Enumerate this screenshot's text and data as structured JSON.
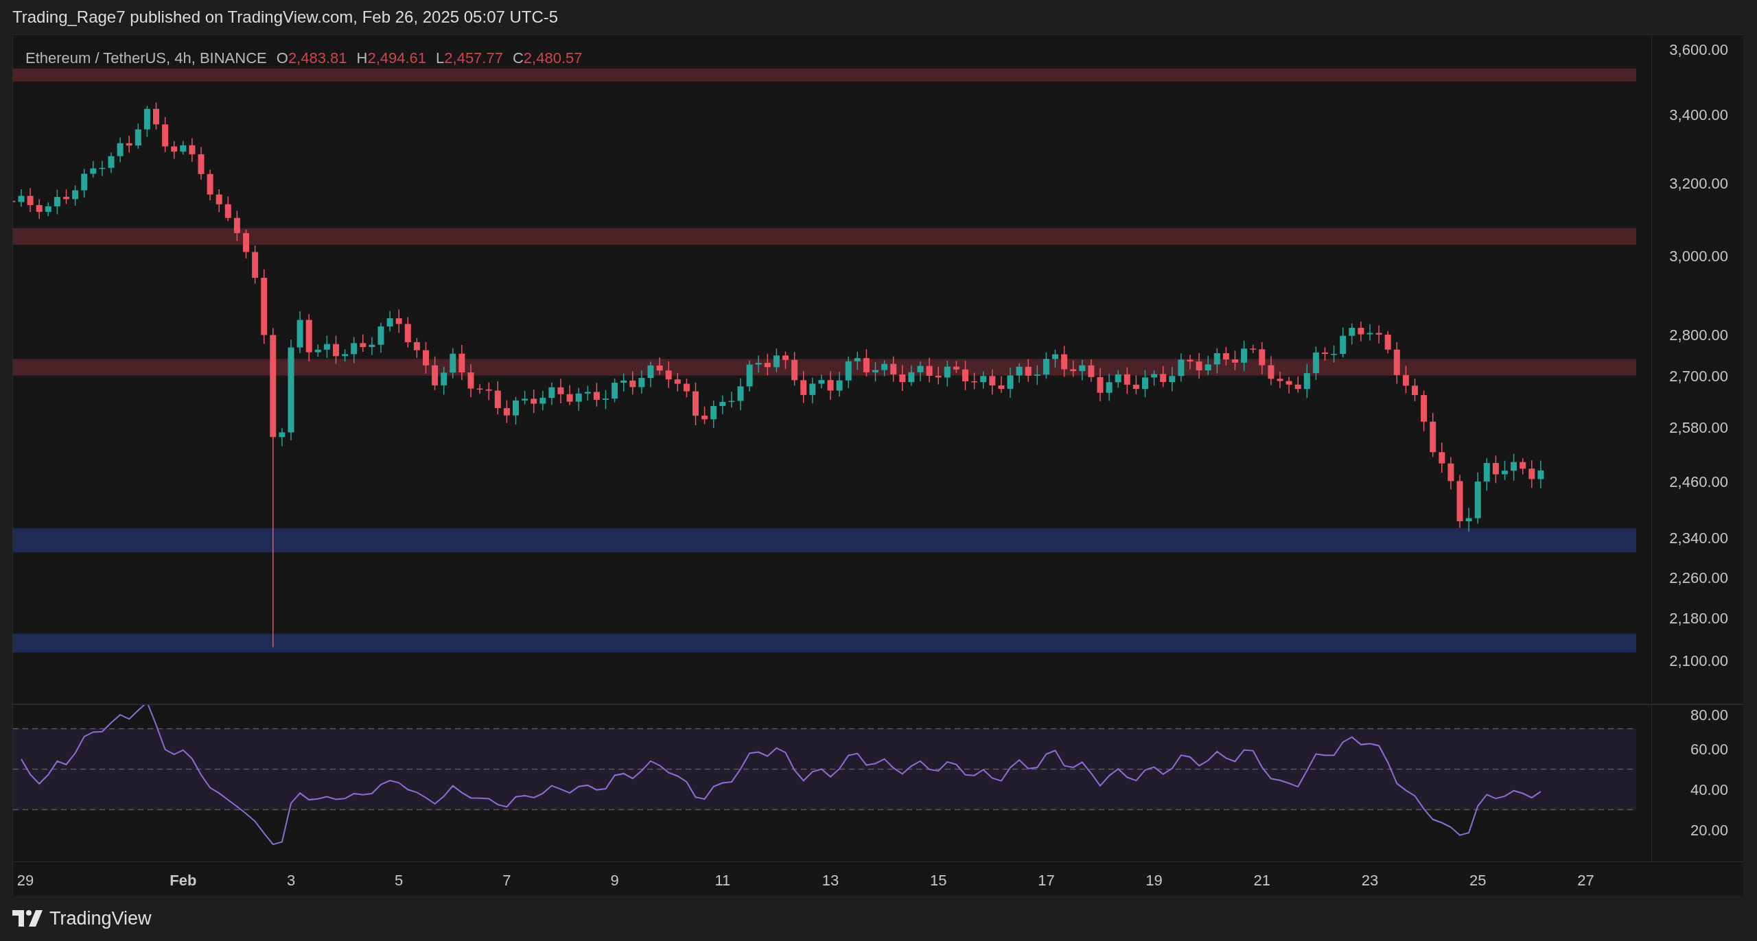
{
  "header": {
    "text": "Trading_Rage7 published on TradingView.com, Feb 26, 2025 05:07 UTC-5"
  },
  "legend": {
    "symbol": "Ethereum / TetherUS, 4h, BINANCE",
    "ohlc": [
      {
        "label": "O",
        "value": "2,483.81"
      },
      {
        "label": "H",
        "value": "2,494.61"
      },
      {
        "label": "L",
        "value": "2,457.77"
      },
      {
        "label": "C",
        "value": "2,480.57"
      }
    ]
  },
  "price_axis": [
    "3,600.00",
    "3,400.00",
    "3,200.00",
    "3,000.00",
    "2,800.00",
    "2,700.00",
    "2,580.00",
    "2,460.00",
    "2,340.00",
    "2,260.00",
    "2,180.00",
    "2,100.00"
  ],
  "rsi_axis": [
    "80.00",
    "60.00",
    "40.00",
    "20.00"
  ],
  "time_axis": [
    {
      "label": "29",
      "bold": false
    },
    {
      "label": "Feb",
      "bold": true
    },
    {
      "label": "3",
      "bold": false
    },
    {
      "label": "5",
      "bold": false
    },
    {
      "label": "7",
      "bold": false
    },
    {
      "label": "9",
      "bold": false
    },
    {
      "label": "11",
      "bold": false
    },
    {
      "label": "13",
      "bold": false
    },
    {
      "label": "15",
      "bold": false
    },
    {
      "label": "17",
      "bold": false
    },
    {
      "label": "19",
      "bold": false
    },
    {
      "label": "21",
      "bold": false
    },
    {
      "label": "23",
      "bold": false
    },
    {
      "label": "25",
      "bold": false
    },
    {
      "label": "27",
      "bold": false
    }
  ],
  "footer": {
    "brand": "TradingView"
  }
}
